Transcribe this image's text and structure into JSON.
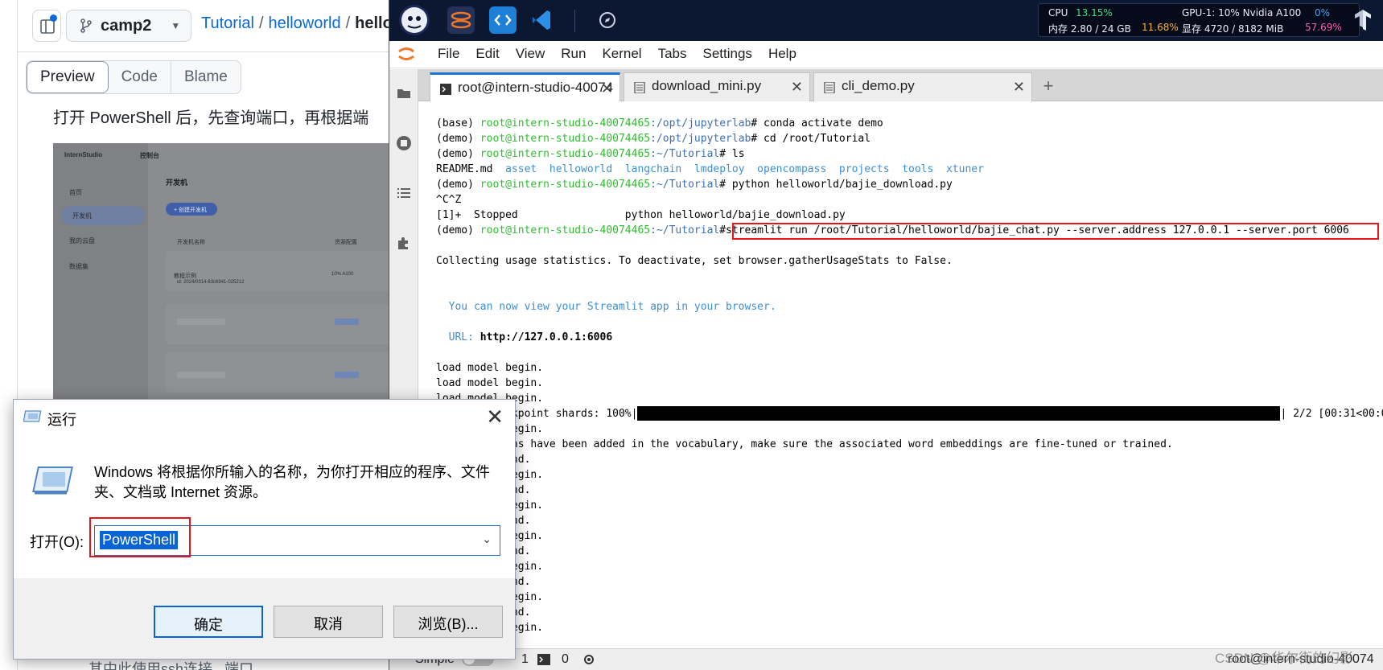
{
  "github": {
    "branch": "camp2",
    "breadcrumb": [
      "Tutorial",
      "helloworld",
      "hello_"
    ],
    "tabs": [
      "Preview",
      "Code",
      "Blame"
    ],
    "paragraph": "打开 PowerShell 后，先查询端口，再根据端",
    "bottom_text": "其中此使用ssh连接...端口",
    "screenshot": {
      "brand": "InternStudio",
      "nav_top": "控制台",
      "menu": [
        "首页",
        "开发机",
        "我的云盘",
        "数据集"
      ],
      "heading": "开发机",
      "create_button": "+ 创建开发机",
      "col_name": "开发机名称",
      "col_resource": "资源配置",
      "machine_name": "教程示例",
      "machine_id": "id: 2024/0314-63c6941-025212",
      "machine_gpu": "10% A100"
    }
  },
  "jupyter": {
    "top_icons": [
      "intern-logo-icon",
      "jupyter-icon",
      "code-icon",
      "vscode-icon",
      "compass-icon"
    ],
    "sys": {
      "cpu_label": "CPU",
      "cpu_value": "13.15%",
      "gpu_label": "GPU-1: 10% Nvidia A100",
      "gpu_value": "0%",
      "mem_label": "内存 2.80 / 24 GB",
      "mem_value": "11.68%",
      "vram_label": "显存 4720 / 8182 MiB",
      "vram_value": "57.69%"
    },
    "menu": [
      "File",
      "Edit",
      "View",
      "Run",
      "Kernel",
      "Tabs",
      "Settings",
      "Help"
    ],
    "tabs": [
      {
        "label": "root@intern-studio-40074",
        "active": true
      },
      {
        "label": "download_mini.py",
        "active": false
      },
      {
        "label": "cli_demo.py",
        "active": false
      }
    ],
    "terminal": {
      "lines": [
        {
          "env": "(base) ",
          "host": "root@intern-studio-40074465",
          "path": ":/opt/jupyterlab",
          "cmd": "# conda activate demo"
        },
        {
          "env": "(demo) ",
          "host": "root@intern-studio-40074465",
          "path": ":/opt/jupyterlab",
          "cmd": "# cd /root/Tutorial"
        },
        {
          "env": "(demo) ",
          "host": "root@intern-studio-40074465",
          "path": ":~/Tutorial",
          "cmd": "# ls"
        },
        {
          "env": "(demo) ",
          "host": "root@intern-studio-40074465",
          "path": ":~/Tutorial",
          "cmd": "# python helloworld/bajie_download.py"
        },
        {
          "env": "(demo) ",
          "host": "root@intern-studio-40074465",
          "path": ":~/Tutorial",
          "cmd": "# "
        }
      ],
      "ls_readme": "README.md",
      "ls_dirs": "asset  helloworld  langchain  lmdeploy  opencompass  projects  tools  xtuner",
      "ctrl": "^C^Z",
      "stopped": "[1]+  Stopped                 python helloworld/bajie_download.py",
      "highlighted_cmd": "streamlit run /root/Tutorial/helloworld/bajie_chat.py --server.address 127.0.0.1 --server.port 6006",
      "usage": "Collecting usage statistics. To deactivate, set browser.gatherUsageStats to False.",
      "view_msg": "  You can now view your Streamlit app in your browser.",
      "url_label": "  URL: ",
      "url": "http://127.0.0.1:6006",
      "load1": "load model begin.",
      "load2": "load model begin.",
      "load3": "load model begin.",
      "shards_prefix": "Loading checkpoint shards: 100%|",
      "shards_suffix": "| 2/2 [00:31<00:00",
      "load4": "load model begin.",
      "special": "Special tokens have been added in the vocabulary, make sure the associated word embeddings are fine-tuned or trained.",
      "tail": [
        "load model end.",
        "load model begin.",
        "load model end.",
        "load model begin.",
        "load model end.",
        "load model begin.",
        "load model end.",
        "load model begin.",
        "load model end.",
        "load model begin.",
        "load model end.",
        "load model begin."
      ]
    },
    "status": {
      "mode": "Simple",
      "count1": "1",
      "count2": "0",
      "right": "root@intern-studio-40074"
    }
  },
  "run_dialog": {
    "title": "运行",
    "description": "Windows 将根据你所输入的名称，为你打开相应的程序、文件夹、文档或 Internet 资源。",
    "open_label": "打开(O):",
    "value": "PowerShell",
    "ok": "确定",
    "cancel": "取消",
    "browse": "浏览(B)..."
  },
  "watermark": "CSDN @华尔街的幻影"
}
